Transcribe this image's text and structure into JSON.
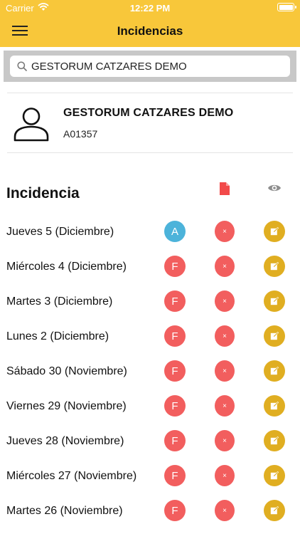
{
  "status_bar": {
    "carrier": "Carrier",
    "time": "12:22 PM"
  },
  "header": {
    "title": "Incidencias",
    "menu_icon": "hamburger-icon",
    "color": "#f8c73a"
  },
  "search": {
    "value": "GESTORUM CATZARES DEMO",
    "icon": "search-icon"
  },
  "user": {
    "name": "GESTORUM CATZARES DEMO",
    "code": "A01357",
    "icon": "user-icon"
  },
  "list": {
    "title": "Incidencia",
    "header_icons": {
      "document": "document-icon",
      "view": "eye-icon"
    },
    "colors": {
      "A": "#4cb3da",
      "F": "#f25e5e",
      "x": "#f25e5e",
      "edit": "#e0ae21"
    },
    "rows": [
      {
        "label": "Jueves 5 (Diciembre)",
        "status": "A",
        "x": "×"
      },
      {
        "label": "Miércoles 4 (Diciembre)",
        "status": "F",
        "x": "×"
      },
      {
        "label": "Martes 3 (Diciembre)",
        "status": "F",
        "x": "×"
      },
      {
        "label": "Lunes 2 (Diciembre)",
        "status": "F",
        "x": "×"
      },
      {
        "label": "Sábado 30 (Noviembre)",
        "status": "F",
        "x": "×"
      },
      {
        "label": "Viernes 29 (Noviembre)",
        "status": "F",
        "x": "×"
      },
      {
        "label": "Jueves 28 (Noviembre)",
        "status": "F",
        "x": "×"
      },
      {
        "label": "Miércoles 27 (Noviembre)",
        "status": "F",
        "x": "×"
      },
      {
        "label": "Martes 26 (Noviembre)",
        "status": "F",
        "x": "×"
      }
    ]
  }
}
